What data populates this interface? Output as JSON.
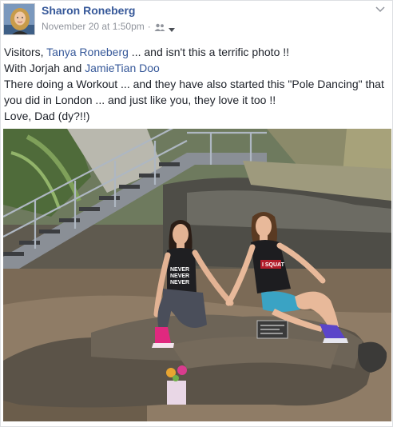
{
  "post": {
    "author_name": "Sharon Roneberg",
    "timestamp": "November 20 at 1:50pm",
    "separator": "·",
    "audience_icon": "friends-icon",
    "caret_icon": "chevron-down-icon",
    "options_icon": "chevron-down-icon",
    "text": {
      "line1_prefix": "Visitors, ",
      "line1_tag": "Tanya Roneberg",
      "line1_suffix": " ... and isn't this a terrific photo !!",
      "line2_prefix": "With Jorjah and ",
      "line2_tag": "JamieTian Doo",
      "line3": "There doing a Workout ... and they have also started this \"Pole Dancing\" that",
      "line4": "you did in London ... and just like you, they love it too !!",
      "line5": "Love, Dad (dy?!!)"
    },
    "photo": {
      "shirt_left_text": "NEVER NEVER NEVER",
      "shirt_right_text": "I SQUAT"
    }
  },
  "colors": {
    "link": "#365899",
    "text": "#1d2129",
    "meta": "#90949c"
  }
}
